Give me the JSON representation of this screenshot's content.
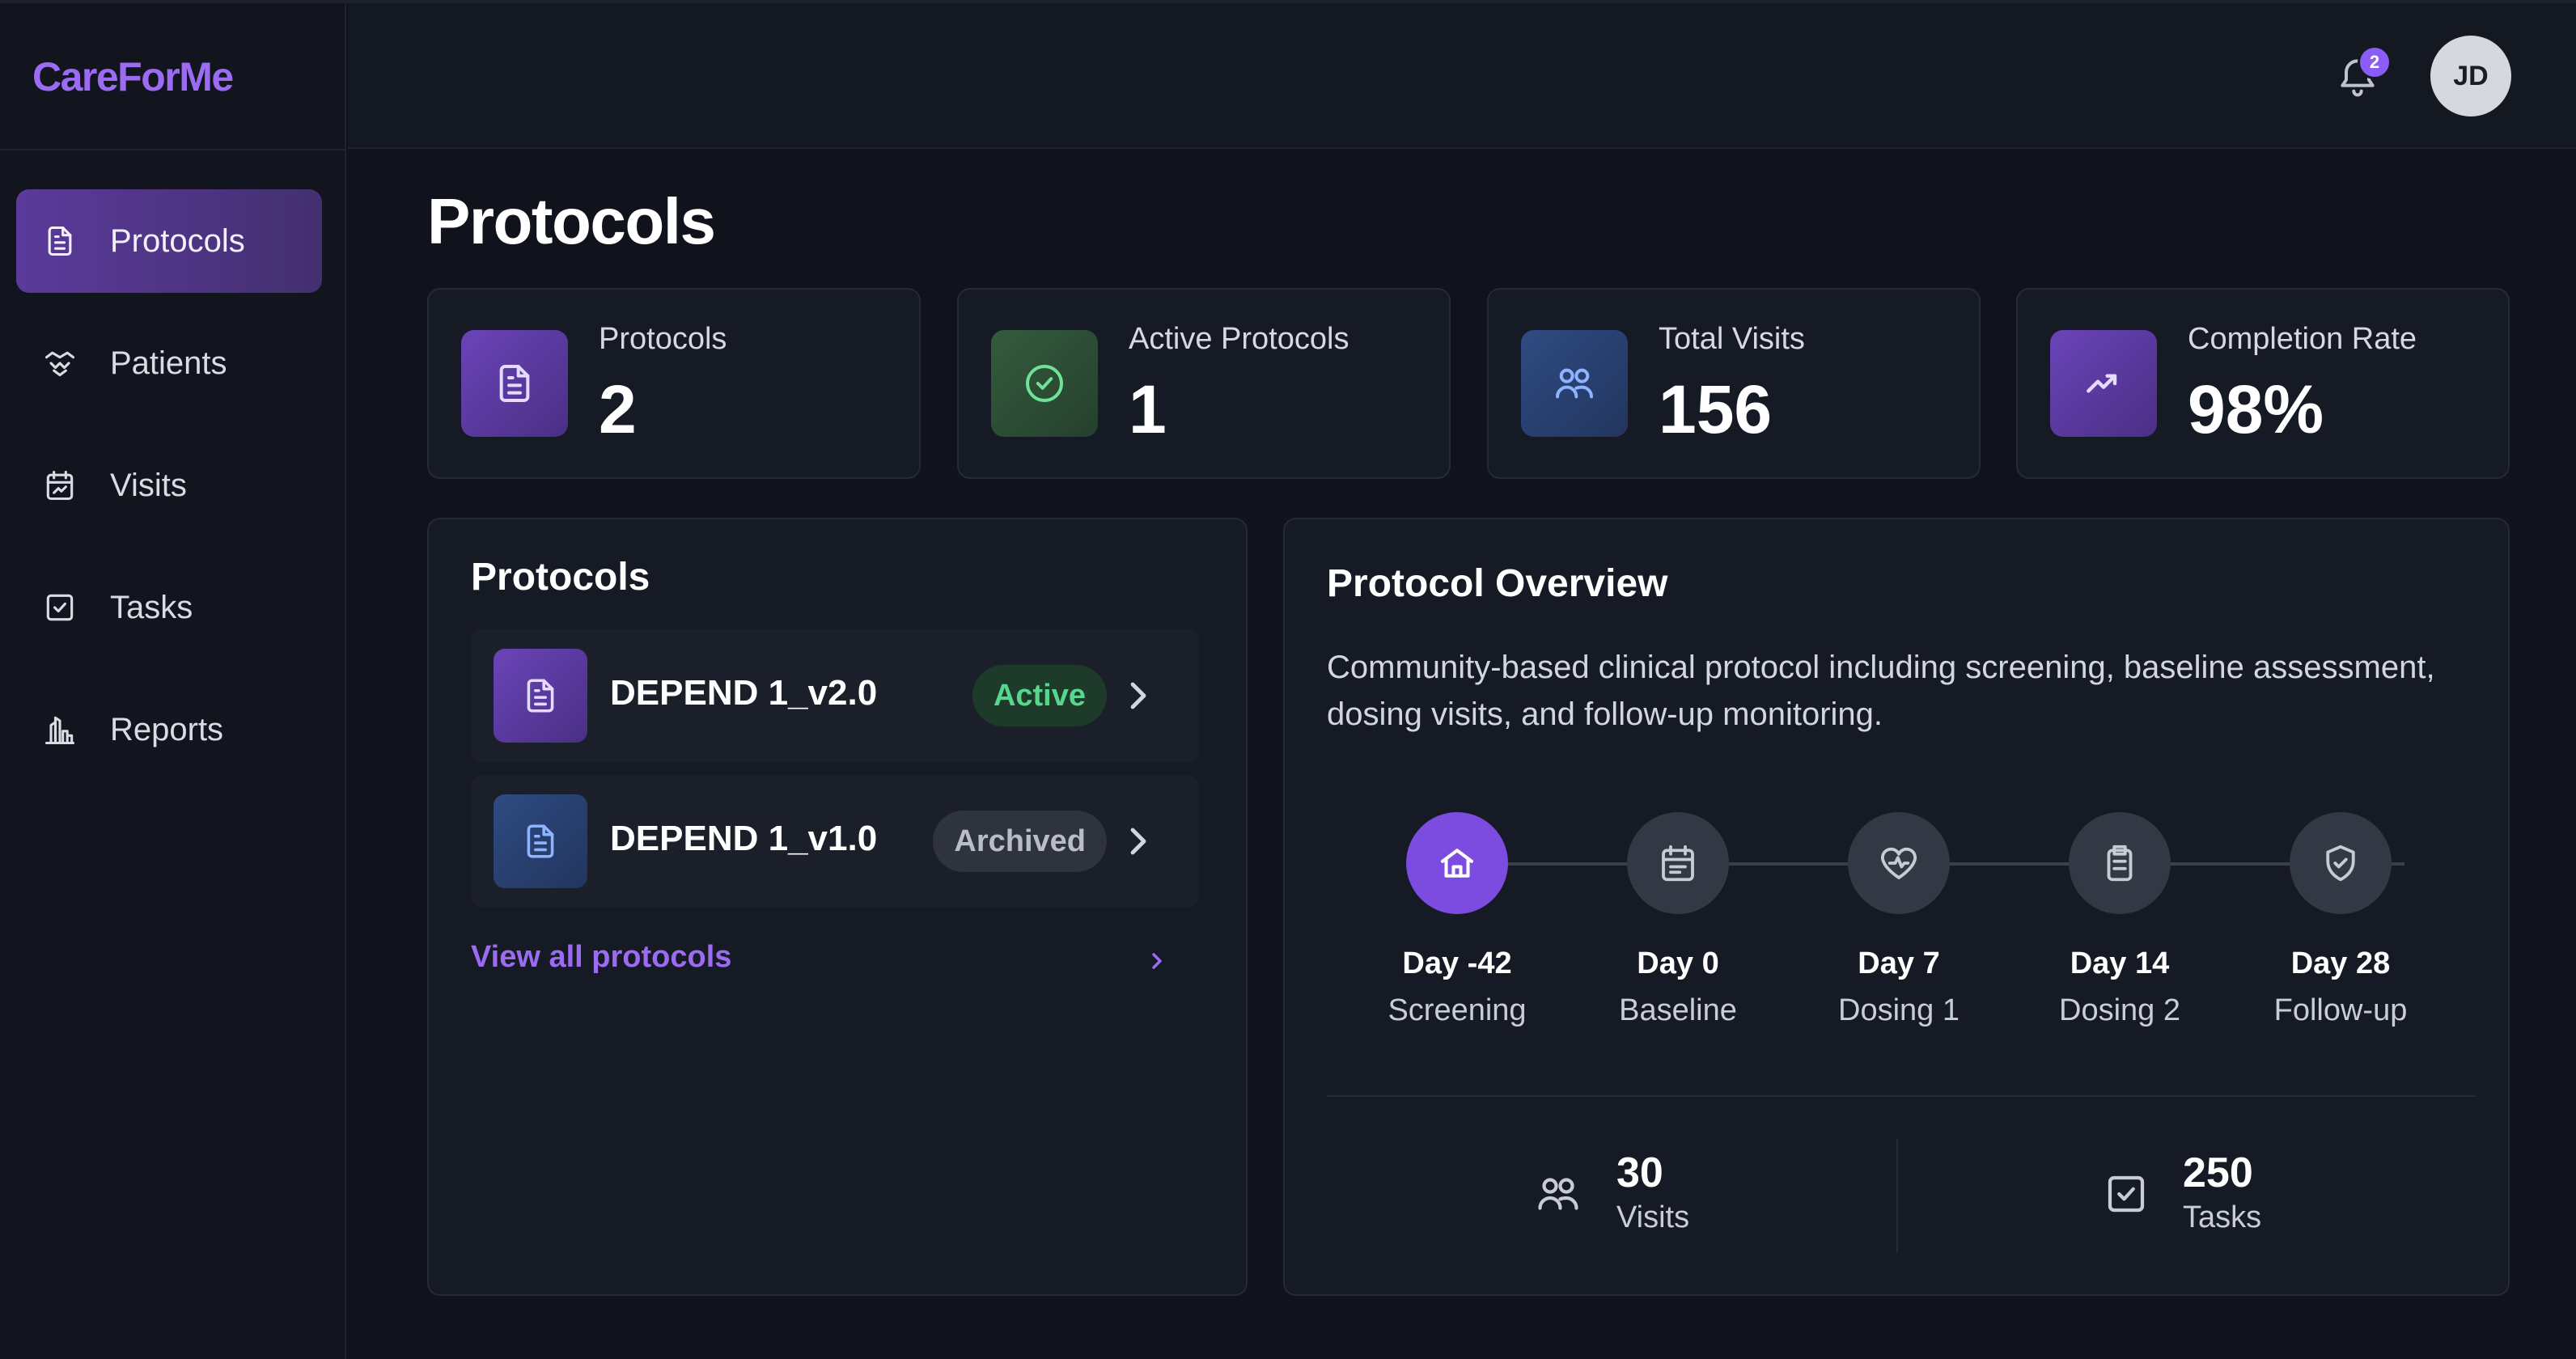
{
  "app": {
    "name": "CareForMe"
  },
  "sidebar": {
    "items": [
      {
        "label": "Protocols",
        "icon": "document-icon",
        "active": true
      },
      {
        "label": "Patients",
        "icon": "people-handshake-icon",
        "active": false
      },
      {
        "label": "Visits",
        "icon": "calendar-icon",
        "active": false
      },
      {
        "label": "Tasks",
        "icon": "checkbox-icon",
        "active": false
      },
      {
        "label": "Reports",
        "icon": "building-chart-icon",
        "active": false
      }
    ]
  },
  "header": {
    "notifications_count": "2",
    "avatar_initials": "JD"
  },
  "page": {
    "title": "Protocols"
  },
  "stats": [
    {
      "label": "Protocols",
      "value": "2",
      "icon": "document-icon",
      "color": "#5b3a9b"
    },
    {
      "label": "Active Protocols",
      "value": "1",
      "icon": "check-circle-icon",
      "color": "#2c4a34"
    },
    {
      "label": "Total Visits",
      "value": "156",
      "icon": "users-icon",
      "color": "#283e6b"
    },
    {
      "label": "Completion Rate",
      "value": "98%",
      "icon": "trending-up-icon",
      "color": "#5b3a9b"
    }
  ],
  "protocols_panel": {
    "title": "Protocols",
    "items": [
      {
        "name": "DEPEND 1_v2.0",
        "status": "Active",
        "icon_color": "#5b3a9b"
      },
      {
        "name": "DEPEND 1_v1.0",
        "status": "Archived",
        "icon_color": "#2b4372"
      }
    ],
    "view_all": "View all protocols"
  },
  "overview": {
    "title": "Protocol Overview",
    "description": "Community-based clinical protocol including screening, baseline assessment, dosing visits, and follow-up monitoring.",
    "steps": [
      {
        "day": "Day -42",
        "name": "Screening",
        "icon": "home-icon",
        "active": true
      },
      {
        "day": "Day 0",
        "name": "Baseline",
        "icon": "calendar-icon",
        "active": false
      },
      {
        "day": "Day 7",
        "name": "Dosing 1",
        "icon": "heart-pulse-icon",
        "active": false
      },
      {
        "day": "Day 14",
        "name": "Dosing 2",
        "icon": "clipboard-icon",
        "active": false
      },
      {
        "day": "Day 28",
        "name": "Follow-up",
        "icon": "shield-check-icon",
        "active": false
      }
    ],
    "summary": {
      "visits_value": "30",
      "visits_label": "Visits",
      "tasks_value": "250",
      "tasks_label": "Tasks"
    }
  },
  "colors": {
    "accent": "#9b6cf2",
    "active_badge": "#58d68d"
  }
}
